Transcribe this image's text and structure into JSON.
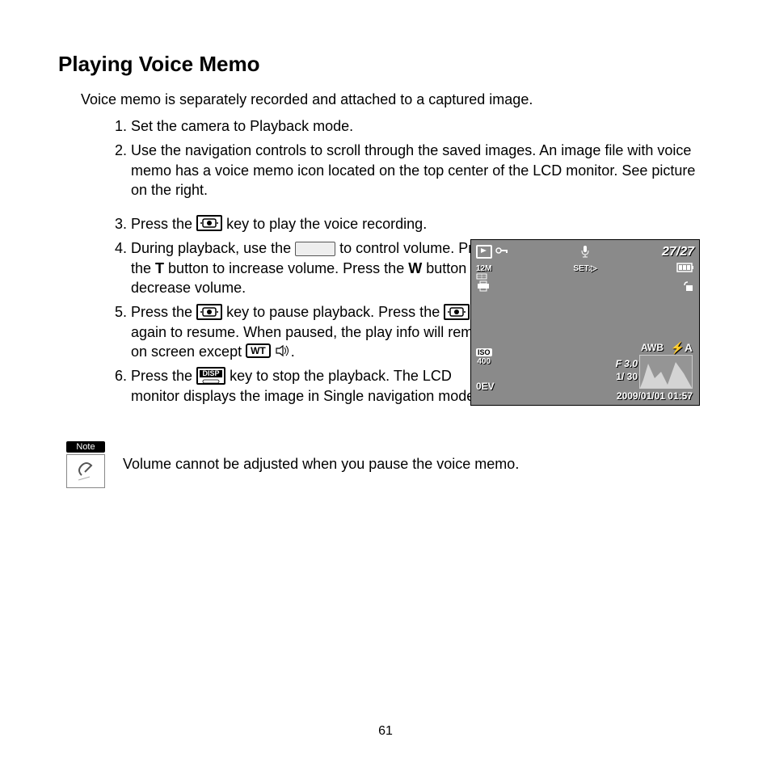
{
  "title": "Playing Voice Memo",
  "intro": "Voice memo is separately recorded and attached to a captured image.",
  "steps": {
    "s1": "Set the camera to Playback mode.",
    "s2": "Use the navigation controls to scroll through the saved images. An image file with voice memo has a voice memo icon located on the top center of the LCD monitor. See picture on the right.",
    "s3_a": "Press the ",
    "s3_b": " key to play the voice recording.",
    "s4_a": "During playback, use the ",
    "s4_b": " to control volume. Press the ",
    "s4_t": "T",
    "s4_c": " button to increase volume. Press the ",
    "s4_w": "W",
    "s4_d": " button to decrease volume.",
    "s5_a": "Press the ",
    "s5_b": " key to pause playback. Press the ",
    "s5_c": " key again to resume. When paused, the play info will remain on screen except ",
    "s5_wt": "WT",
    "s5_d": ".",
    "s6_a": "Press the ",
    "s6_disp": "DISP",
    "s6_b": " key to stop the playback. The LCD monitor displays the image in Single navigation mode."
  },
  "note": {
    "label": "Note",
    "text": "Volume cannot be adjusted when you pause the voice memo."
  },
  "lcd": {
    "counter": "27/27",
    "resolution": "12M",
    "set": "SET:▷",
    "iso_label": "ISO",
    "iso_value": "400",
    "ev": "0EV",
    "awb": "AWB",
    "flash": "⚡A",
    "fstop": "F 3.0",
    "shutter": "1/ 30",
    "datetime": "2009/01/01  01:57"
  },
  "page_number": "61"
}
